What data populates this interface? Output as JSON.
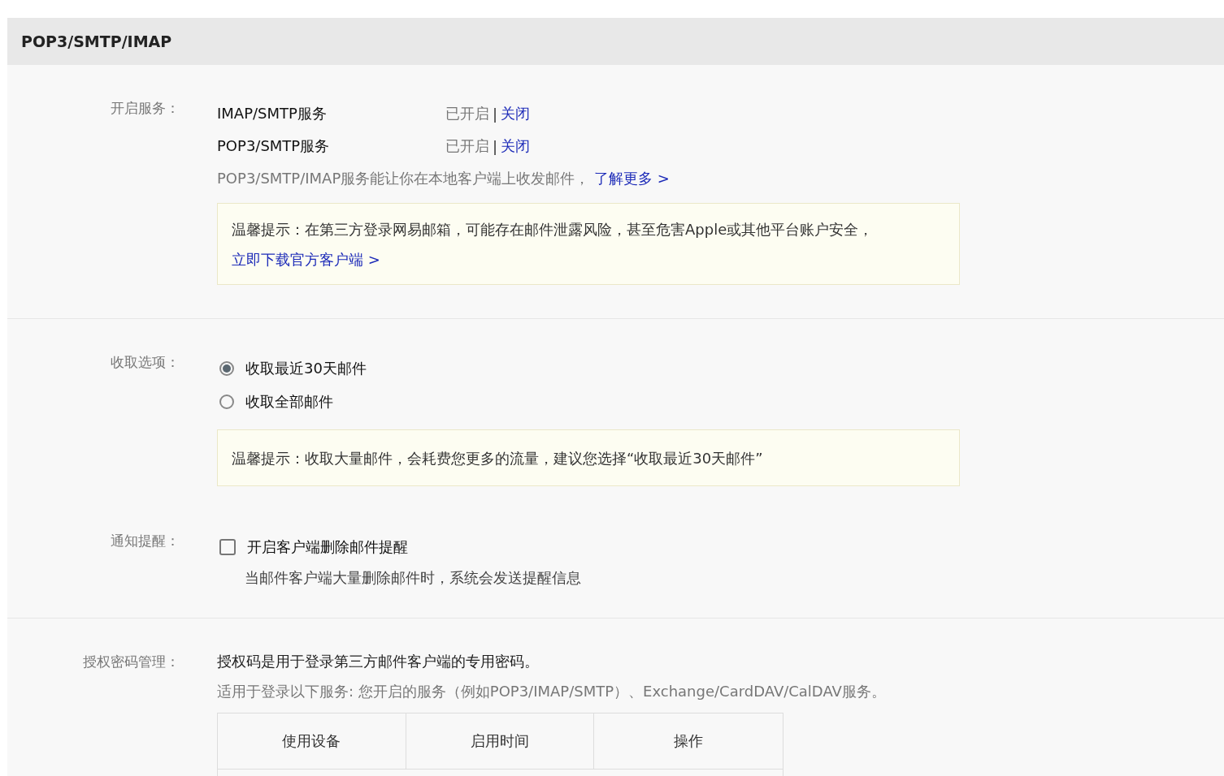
{
  "panel": {
    "title": "POP3/SMTP/IMAP"
  },
  "services": {
    "label": "开启服务：",
    "items": [
      {
        "name": "IMAP/SMTP服务",
        "status": "已开启",
        "separator": "|",
        "action": "关闭"
      },
      {
        "name": "POP3/SMTP服务",
        "status": "已开启",
        "separator": "|",
        "action": "关闭"
      }
    ],
    "description": "POP3/SMTP/IMAP服务能让你在本地客户端上收发邮件，",
    "link": "了解更多 >",
    "notice": {
      "text": "温馨提示：在第三方登录网易邮箱，可能存在邮件泄露风险，甚至危害Apple或其他平台账户安全，",
      "link": "立即下载官方客户端 >"
    }
  },
  "fetch": {
    "label": "收取选项：",
    "options": [
      {
        "label": "收取最近30天邮件",
        "selected": true
      },
      {
        "label": "收取全部邮件",
        "selected": false
      }
    ],
    "notice": "温馨提示：收取大量邮件，会耗费您更多的流量，建议您选择“收取最近30天邮件”"
  },
  "notify": {
    "label": "通知提醒：",
    "option": {
      "label": "开启客户端删除邮件提醒",
      "checked": false
    },
    "hint": "当邮件客户端大量删除邮件时，系统会发送提醒信息"
  },
  "auth": {
    "label": "授权密码管理：",
    "intro": "授权码是用于登录第三方邮件客户端的专用密码。",
    "description": "适用于登录以下服务: 您开启的服务（例如POP3/IMAP/SMTP）、Exchange/CardDAV/CalDAV服务。",
    "table": {
      "columns": [
        "使用设备",
        "启用时间",
        "操作"
      ]
    }
  }
}
